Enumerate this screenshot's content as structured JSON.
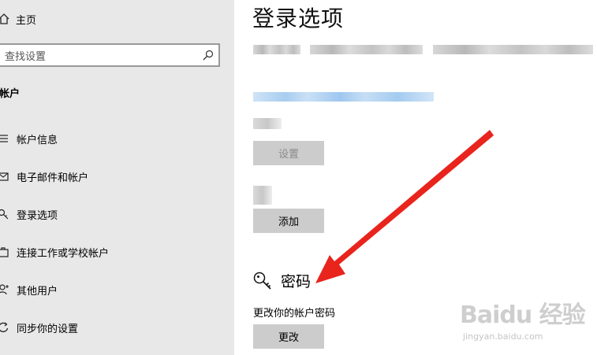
{
  "sidebar": {
    "home_label": "主页",
    "search_placeholder": "查找设置",
    "section_title": "帐户",
    "items": [
      {
        "label": "帐户信息",
        "icon": "account-info-icon"
      },
      {
        "label": "电子邮件和帐户",
        "icon": "email-icon"
      },
      {
        "label": "登录选项",
        "icon": "key-icon"
      },
      {
        "label": "连接工作或学校帐户",
        "icon": "briefcase-icon"
      },
      {
        "label": "其他用户",
        "icon": "person-add-icon"
      },
      {
        "label": "同步你的设置",
        "icon": "sync-icon"
      }
    ]
  },
  "main": {
    "title": "登录选项",
    "setup_button": "设置",
    "add_button": "添加",
    "password_heading": "密码",
    "password_icon": "key-icon",
    "password_description": "更改你的帐户密码",
    "change_button": "更改"
  },
  "annotation": {
    "arrow_color": "#e8241d"
  },
  "watermark": {
    "logo": "Baidu 经验",
    "url": "jingyan.baidu.com"
  }
}
